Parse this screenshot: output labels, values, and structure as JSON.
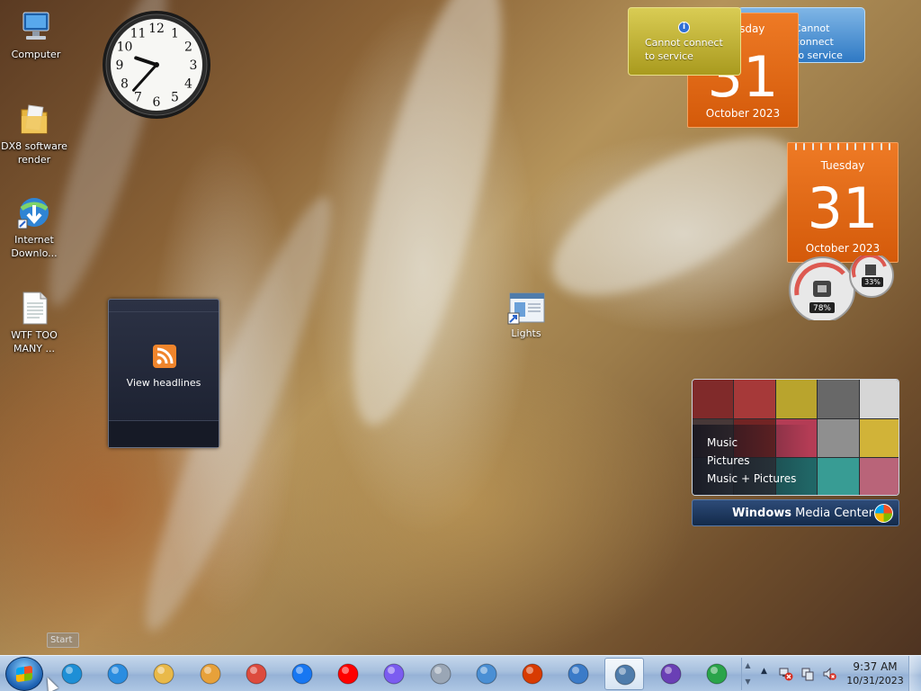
{
  "desktop": {
    "icons": [
      {
        "label": "Computer",
        "icon": "computer-icon"
      },
      {
        "label": "DX8 software\nrender",
        "icon": "folder-icon"
      },
      {
        "label": "Internet\nDownlo...",
        "icon": "internet-download-manager-icon"
      },
      {
        "label": "WTF TOO\nMANY ...",
        "icon": "text-document-icon"
      }
    ],
    "lights_shortcut": {
      "label": "Lights",
      "icon": "lights-shortcut-icon"
    }
  },
  "gadgets": {
    "clock": {
      "hour": 9,
      "minute": 37,
      "numbers": [
        "12",
        "1",
        "2",
        "3",
        "4",
        "5",
        "6",
        "7",
        "8",
        "9",
        "10",
        "11"
      ]
    },
    "rss": {
      "label": "View headlines",
      "icon": "rss-feed-icon"
    },
    "weather_blue": {
      "text": "Cannot connect\nto service"
    },
    "weather_gold": {
      "text": "Cannot connect\nto service",
      "info_icon": "i"
    },
    "calendar_back": {
      "dow": "Tuesday",
      "day": "31",
      "month_year": "October 2023"
    },
    "calendar_front": {
      "dow": "Tuesday",
      "day": "31",
      "month_year": "October 2023"
    },
    "cpu_meter": {
      "cpu_percent": "78%",
      "memory_percent": "33%"
    },
    "media_center": {
      "items": [
        "Music",
        "Pictures",
        "Music + Pictures"
      ],
      "title_bold": "Windows",
      "title_rest": " Media Center"
    }
  },
  "tooltip": {
    "text": "Start"
  },
  "taskbar": {
    "apps": [
      {
        "name": "microsoft-edge-icon",
        "color": "#1e8fd6"
      },
      {
        "name": "internet-explorer-icon",
        "color": "#2b8de0"
      },
      {
        "name": "file-explorer-icon",
        "color": "#e9b949"
      },
      {
        "name": "media-player-icon",
        "color": "#e7a13a"
      },
      {
        "name": "chrome-icon",
        "color": "#dd4b3e"
      },
      {
        "name": "facebook-icon",
        "color": "#1877f2"
      },
      {
        "name": "youtube-icon",
        "color": "#ff0000"
      },
      {
        "name": "copilot-icon",
        "color": "#7b5cf0"
      },
      {
        "name": "scanner-icon",
        "color": "#9aa6b5"
      },
      {
        "name": "control-panel-icon",
        "color": "#4a8fd4"
      },
      {
        "name": "office-icon",
        "color": "#d83b01"
      },
      {
        "name": "remote-desktop-icon",
        "color": "#3b7bc8"
      },
      {
        "name": "lights-app-icon",
        "color": "#4f7cab"
      },
      {
        "name": "media-center-icon",
        "color": "#6a3fb5"
      },
      {
        "name": "internet-download-manager-icon",
        "color": "#2aa44a"
      }
    ],
    "active_index": 12,
    "tray": {
      "time": "9:37 AM",
      "date": "10/31/2023",
      "icons": [
        "network-error-icon",
        "action-center-icon",
        "volume-muted-icon"
      ]
    }
  },
  "colors": {
    "calendar_orange": "#e8691a",
    "taskbar": "#a6bfdd",
    "weather_gold": "#cfc042",
    "weather_blue": "#4a8fd4"
  }
}
